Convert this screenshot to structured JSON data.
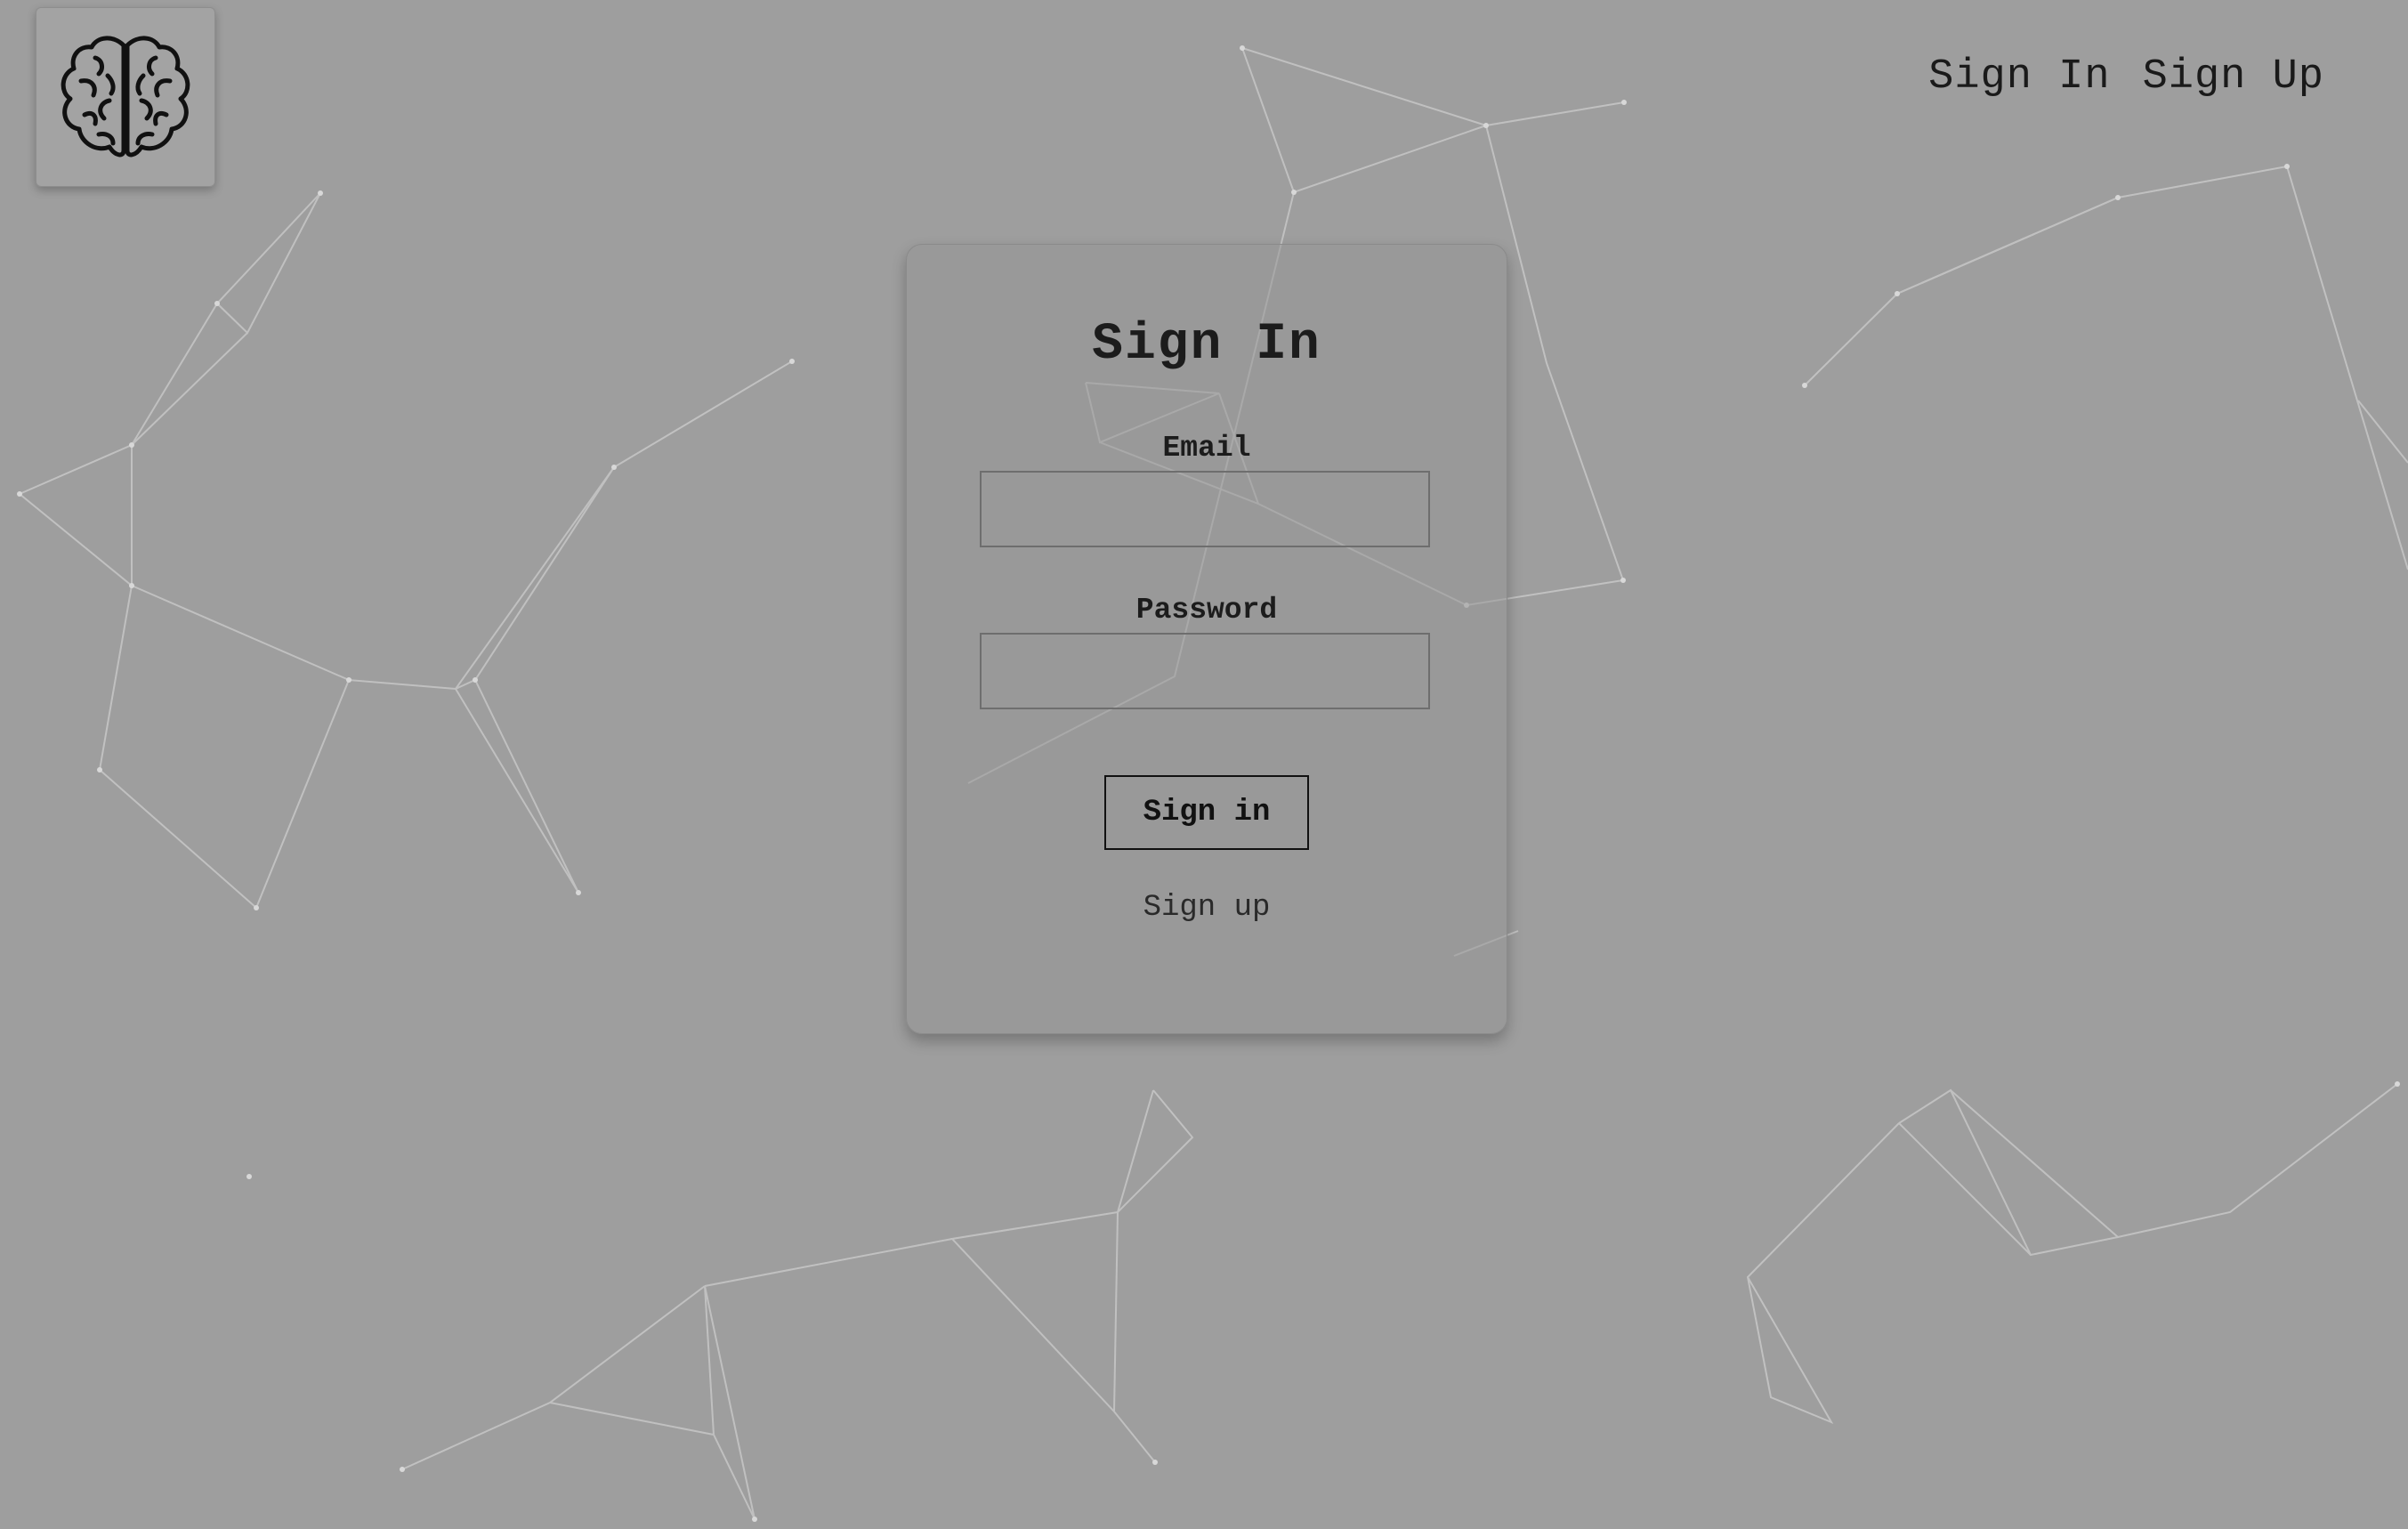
{
  "nav": {
    "sign_in": "Sign In",
    "sign_up": "Sign Up"
  },
  "logo": {
    "icon": "brain-icon"
  },
  "form": {
    "title": "Sign In",
    "email_label": "Email",
    "email_value": "",
    "password_label": "Password",
    "password_value": "",
    "submit_label": "Sign in",
    "signup_link": "Sign up"
  },
  "colors": {
    "background": "#9e9e9e",
    "text": "#1c1c1c",
    "network_lines": "#c8c8c8"
  }
}
